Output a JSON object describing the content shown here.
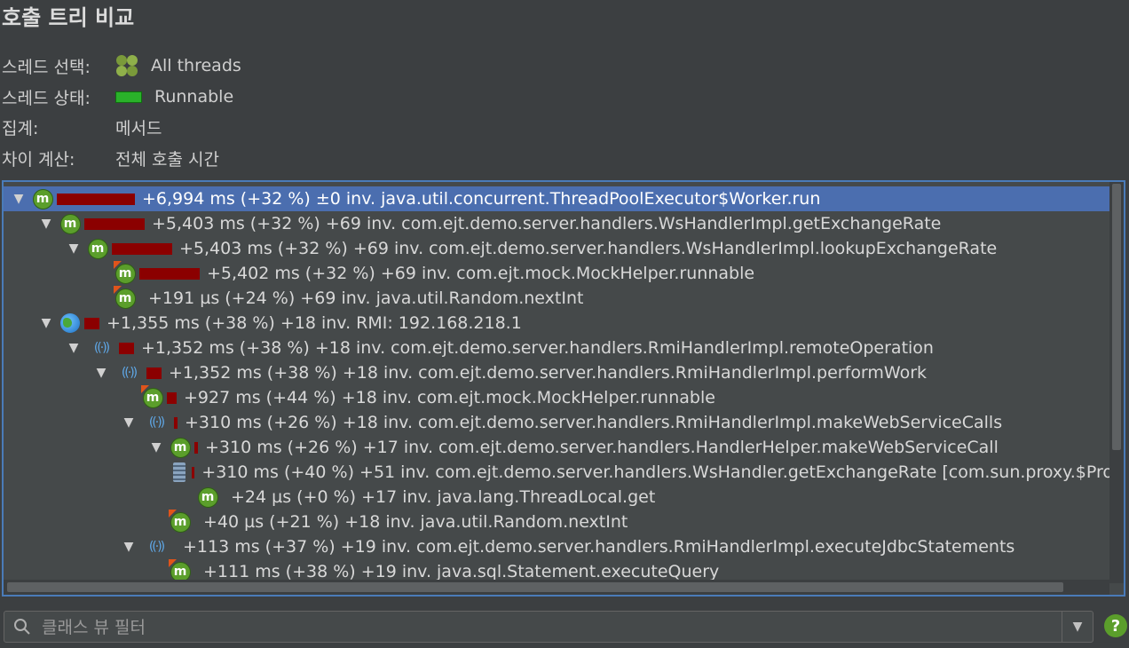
{
  "title": "호출 트리 비교",
  "info": {
    "thread_label": "스레드 선택:",
    "thread_value": "All threads",
    "state_label": "스레드 상태:",
    "state_value": "Runnable",
    "aggregation_label": "집계:",
    "aggregation_value": "메서드",
    "diff_label": "차이 계산:",
    "diff_value": "전체 호출 시간"
  },
  "tree": [
    {
      "text": "+6,994 ms (+32 %) ±0 inv. java.util.concurrent.ThreadPoolExecutor$Worker.run",
      "icon": "method-icon",
      "depth": 0,
      "expanded": true,
      "bar": 88,
      "selected": true
    },
    {
      "text": "+5,403 ms (+32 %) +69 inv. com.ejt.demo.server.handlers.WsHandlerImpl.getExchangeRate",
      "icon": "method-icon",
      "depth": 1,
      "expanded": true,
      "bar": 68
    },
    {
      "text": "+5,403 ms (+32 %) +69 inv. com.ejt.demo.server.handlers.WsHandlerImpl.lookupExchangeRate",
      "icon": "method-icon",
      "depth": 2,
      "expanded": true,
      "bar": 68
    },
    {
      "text": "+5,402 ms (+32 %) +69 inv. com.ejt.mock.MockHelper.runnable",
      "icon": "method-icon",
      "depth": 3,
      "flag": true,
      "bar": 68
    },
    {
      "text": "+191 µs (+24 %) +69 inv. java.util.Random.nextInt",
      "icon": "method-icon",
      "depth": 3,
      "flag": true,
      "bar": 0
    },
    {
      "text": "+1,355 ms (+38 %) +18 inv. RMI: 192.168.218.1",
      "icon": "globe-icon",
      "depth": 1,
      "expanded": true,
      "bar": 17
    },
    {
      "text": "+1,352 ms (+38 %) +18 inv. com.ejt.demo.server.handlers.RmiHandlerImpl.remoteOperation",
      "icon": "rmi-icon",
      "depth": 2,
      "expanded": true,
      "bar": 17
    },
    {
      "text": "+1,352 ms (+38 %) +18 inv. com.ejt.demo.server.handlers.RmiHandlerImpl.performWork",
      "icon": "rmi-icon",
      "depth": 3,
      "expanded": true,
      "bar": 17
    },
    {
      "text": "+927 ms (+44 %) +18 inv. com.ejt.mock.MockHelper.runnable",
      "icon": "method-icon",
      "depth": 4,
      "flag": true,
      "bar": 11
    },
    {
      "text": "+310 ms (+26 %) +18 inv. com.ejt.demo.server.handlers.RmiHandlerImpl.makeWebServiceCalls",
      "icon": "rmi-icon",
      "depth": 4,
      "expanded": true,
      "bar": 4
    },
    {
      "text": "+310 ms (+26 %) +17 inv. com.ejt.demo.server.handlers.HandlerHelper.makeWebServiceCall",
      "icon": "method-icon",
      "depth": 5,
      "expanded": true,
      "bar": 4
    },
    {
      "text": "+310 ms (+40 %) +51 inv. com.ejt.demo.server.handlers.WsHandler.getExchangeRate [com.sun.proxy.$Pro",
      "icon": "webservice-icon",
      "depth": 6,
      "bar": 4
    },
    {
      "text": "+24 µs (+0 %) +17 inv. java.lang.ThreadLocal.get",
      "icon": "method-icon",
      "depth": 6,
      "bar": 0
    },
    {
      "text": "+40 µs (+21 %) +18 inv. java.util.Random.nextInt",
      "icon": "method-icon",
      "depth": 5,
      "flag": true,
      "bar": 0
    },
    {
      "text": "+113 ms (+37 %) +19 inv. com.ejt.demo.server.handlers.RmiHandlerImpl.executeJdbcStatements",
      "icon": "rmi-icon",
      "depth": 4,
      "expanded": true,
      "bar": 0
    },
    {
      "text": "+111 ms (+38 %) +19 inv. java.sql.Statement.executeQuery",
      "icon": "method-icon",
      "depth": 5,
      "flag": true,
      "bar": 0
    }
  ],
  "filter": {
    "placeholder": "클래스 뷰 필터"
  },
  "help_label": "?"
}
